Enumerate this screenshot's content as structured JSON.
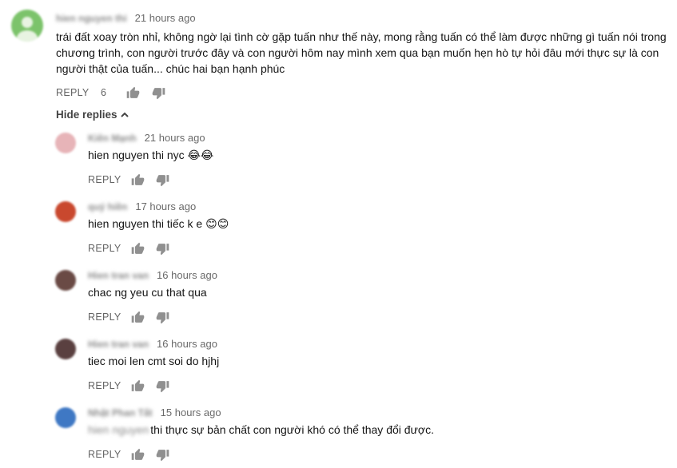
{
  "main_comment": {
    "author": "hien nguyen thi",
    "time": "21 hours ago",
    "lines": [
      "trái đất xoay tròn nhỉ, không ngờ lại tình cờ gặp tuấn như thế này, mong rằng tuấn có thể làm được những gì tuấn nói trong",
      "chương trình, con người trước đây và con người hôm nay mình xem qua bạn muốn hẹn hò tự hỏi đâu mới thực sự là con",
      "người thật của tuấn... chúc hai bạn hạnh phúc"
    ],
    "reply_label": "REPLY",
    "like_count": "6"
  },
  "hide_replies_label": "Hide replies",
  "replies": [
    {
      "author": "Kiên Mạnh",
      "time": "21 hours ago",
      "text": "hien nguyen thi nyc 😂😂",
      "reply_label": "REPLY",
      "avatar_color": "#e7b4b8"
    },
    {
      "author": "quý hiền",
      "time": "17 hours ago",
      "text": "hien nguyen thi tiếc k e 😊😊",
      "reply_label": "REPLY",
      "avatar_color": "#c9482e"
    },
    {
      "author": "Hien tran van",
      "time": "16 hours ago",
      "text": "chac ng yeu cu that qua",
      "reply_label": "REPLY",
      "avatar_color": "#6a4a45"
    },
    {
      "author": "Hien tran van",
      "time": "16 hours ago",
      "text": "tiec moi len cmt soi do hjhj",
      "reply_label": "REPLY",
      "avatar_color": "#5a4040"
    },
    {
      "author": "Nhật Phan Tất",
      "time": "15 hours ago",
      "mention": "hien nguyen",
      "text": "thi thực sự bản chất con người khó có thể thay đổi được.",
      "reply_label": "REPLY",
      "avatar_color": "#3f78c4"
    }
  ]
}
